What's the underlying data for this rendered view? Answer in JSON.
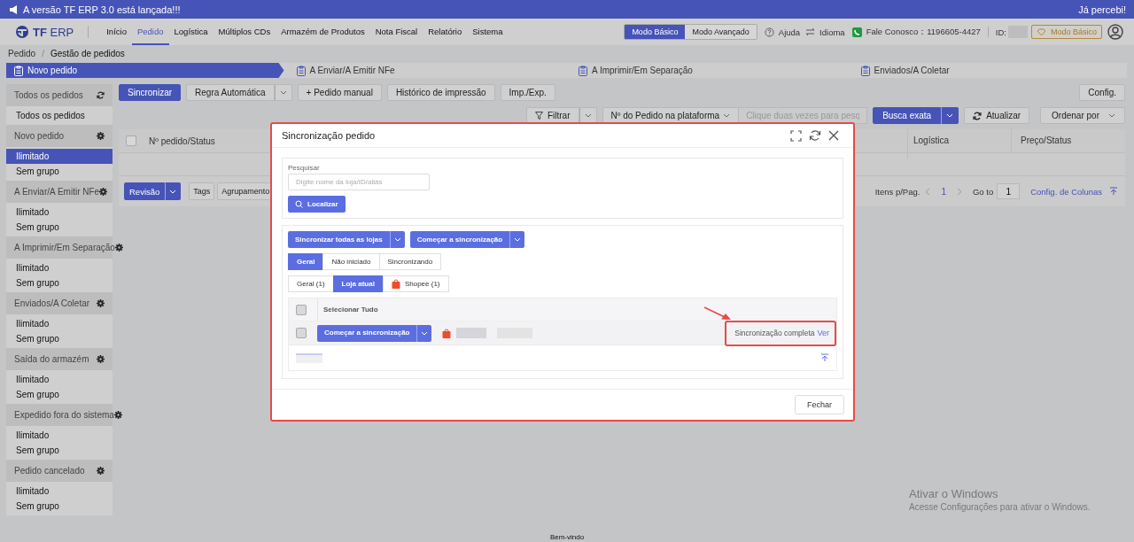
{
  "banner": {
    "text": "A versão TF ERP 3.0 está lançada!!!",
    "dismiss": "Já percebi!"
  },
  "nav": {
    "logo_bold": "TF",
    "logo_light": "ERP",
    "items": [
      {
        "label": "Início",
        "selected": false
      },
      {
        "label": "Pedido",
        "selected": true
      },
      {
        "label": "Logística",
        "selected": false
      },
      {
        "label": "Múltiplos CDs",
        "selected": false
      },
      {
        "label": "Armazém de Produtos",
        "selected": false
      },
      {
        "label": "Nota Fiscal",
        "selected": false
      },
      {
        "label": "Relatório",
        "selected": false
      },
      {
        "label": "Sistema",
        "selected": false
      }
    ],
    "modes": [
      {
        "label": "Modo Básico",
        "selected": true
      },
      {
        "label": "Modo Avançado",
        "selected": false
      }
    ],
    "help": "Ajuda",
    "language": "Idioma",
    "contact": "Fale Conosco：1196605-4427",
    "id_label": "ID:",
    "plan": "Modo Básico"
  },
  "breadcrumb": {
    "items": [
      "Pedido",
      "Gestão de pedidos"
    ],
    "separator": "/"
  },
  "steps": [
    {
      "label": "Novo pedido",
      "selected": true
    },
    {
      "label": "A Enviar/A Emitir NFe",
      "selected": false
    },
    {
      "label": "A Imprimir/Em Separação",
      "selected": false
    },
    {
      "label": "Enviados/A Coletar",
      "selected": false
    }
  ],
  "sidebar": [
    {
      "title": "Todos os pedidos",
      "items": [
        {
          "label": "Todos os pedidos",
          "selected": false
        }
      ]
    },
    {
      "title": "Novo pedido",
      "items": [
        {
          "label": "Ilimitado",
          "selected": true
        },
        {
          "label": "Sem grupo",
          "selected": false
        }
      ]
    },
    {
      "title": "A Enviar/A Emitir NFe",
      "items": [
        {
          "label": "Ilimitado",
          "selected": false
        },
        {
          "label": "Sem grupo",
          "selected": false
        }
      ]
    },
    {
      "title": "A Imprimir/Em Separação",
      "items": [
        {
          "label": "Ilimitado",
          "selected": false
        },
        {
          "label": "Sem grupo",
          "selected": false
        }
      ]
    },
    {
      "title": "Enviados/A Coletar",
      "items": [
        {
          "label": "Ilimitado",
          "selected": false
        },
        {
          "label": "Sem grupo",
          "selected": false
        }
      ]
    },
    {
      "title": "Saída do armazém",
      "items": [
        {
          "label": "Ilimitado",
          "selected": false
        },
        {
          "label": "Sem grupo",
          "selected": false
        }
      ]
    },
    {
      "title": "Expedido fora do sistema",
      "items": [
        {
          "label": "Ilimitado",
          "selected": false
        },
        {
          "label": "Sem grupo",
          "selected": false
        }
      ]
    },
    {
      "title": "Pedido cancelado",
      "items": [
        {
          "label": "Ilimitado",
          "selected": false
        },
        {
          "label": "Sem grupo",
          "selected": false
        }
      ]
    }
  ],
  "toolbar": {
    "buttons": [
      {
        "label": "Sincronizar",
        "kind": "primary"
      },
      {
        "label": "Regra Automática",
        "kind": "dropdown"
      },
      {
        "label": "+ Pedido manual",
        "kind": "plain"
      },
      {
        "label": "Histórico de impressão",
        "kind": "plain"
      },
      {
        "label": "Imp./Exp.",
        "kind": "plain"
      }
    ],
    "config": "Config."
  },
  "filters": {
    "filter": "Filtrar",
    "field": "Nº do Pedido na plataforma",
    "placeholder": "Clique duas vezes para pesq",
    "search": "Busca exata",
    "refresh": "Atualizar",
    "sort": "Ordenar por"
  },
  "table": {
    "all_checked": false,
    "columns": [
      "Nº pedido/Status",
      "Logística",
      "Preço/Status"
    ]
  },
  "bottom": {
    "review": "Revisão",
    "tags": "Tags",
    "grouping": "Agrupamento",
    "per_page": "Itens p/Pag.",
    "page": "1",
    "goto": "Go to",
    "goto_value": "1",
    "columns_link": "Config. de Colunas"
  },
  "modal": {
    "title": "Sincronização pedido",
    "search_label": "Pesquisar",
    "placeholder": "Digite nome da loja/ID/aliás",
    "find": "Localizar",
    "actions": [
      "Sincronizar todas as lojas",
      "Começar a sincronização"
    ],
    "status_tabs": [
      {
        "label": "Geral",
        "selected": true
      },
      {
        "label": "Não iniciado",
        "selected": false
      },
      {
        "label": "Sincronizando",
        "selected": false
      }
    ],
    "store_tabs": [
      {
        "label": "Geral (1)",
        "selected": false,
        "kind": "plain"
      },
      {
        "label": "Loja atual",
        "selected": true,
        "kind": "plain"
      },
      {
        "label": "Shopee (1)",
        "selected": false,
        "kind": "shop"
      }
    ],
    "select_all": "Selecionar Tudo",
    "all_checked": false,
    "row": {
      "checked": false,
      "button": "Começar a sincronização",
      "status": "Sincronização completa",
      "link": "Ver"
    },
    "close": "Fechar"
  },
  "footer": "Bem-vindo",
  "watermark": {
    "title": "Ativar o Windows",
    "text": "Acesse Configurações para ativar o Windows."
  }
}
